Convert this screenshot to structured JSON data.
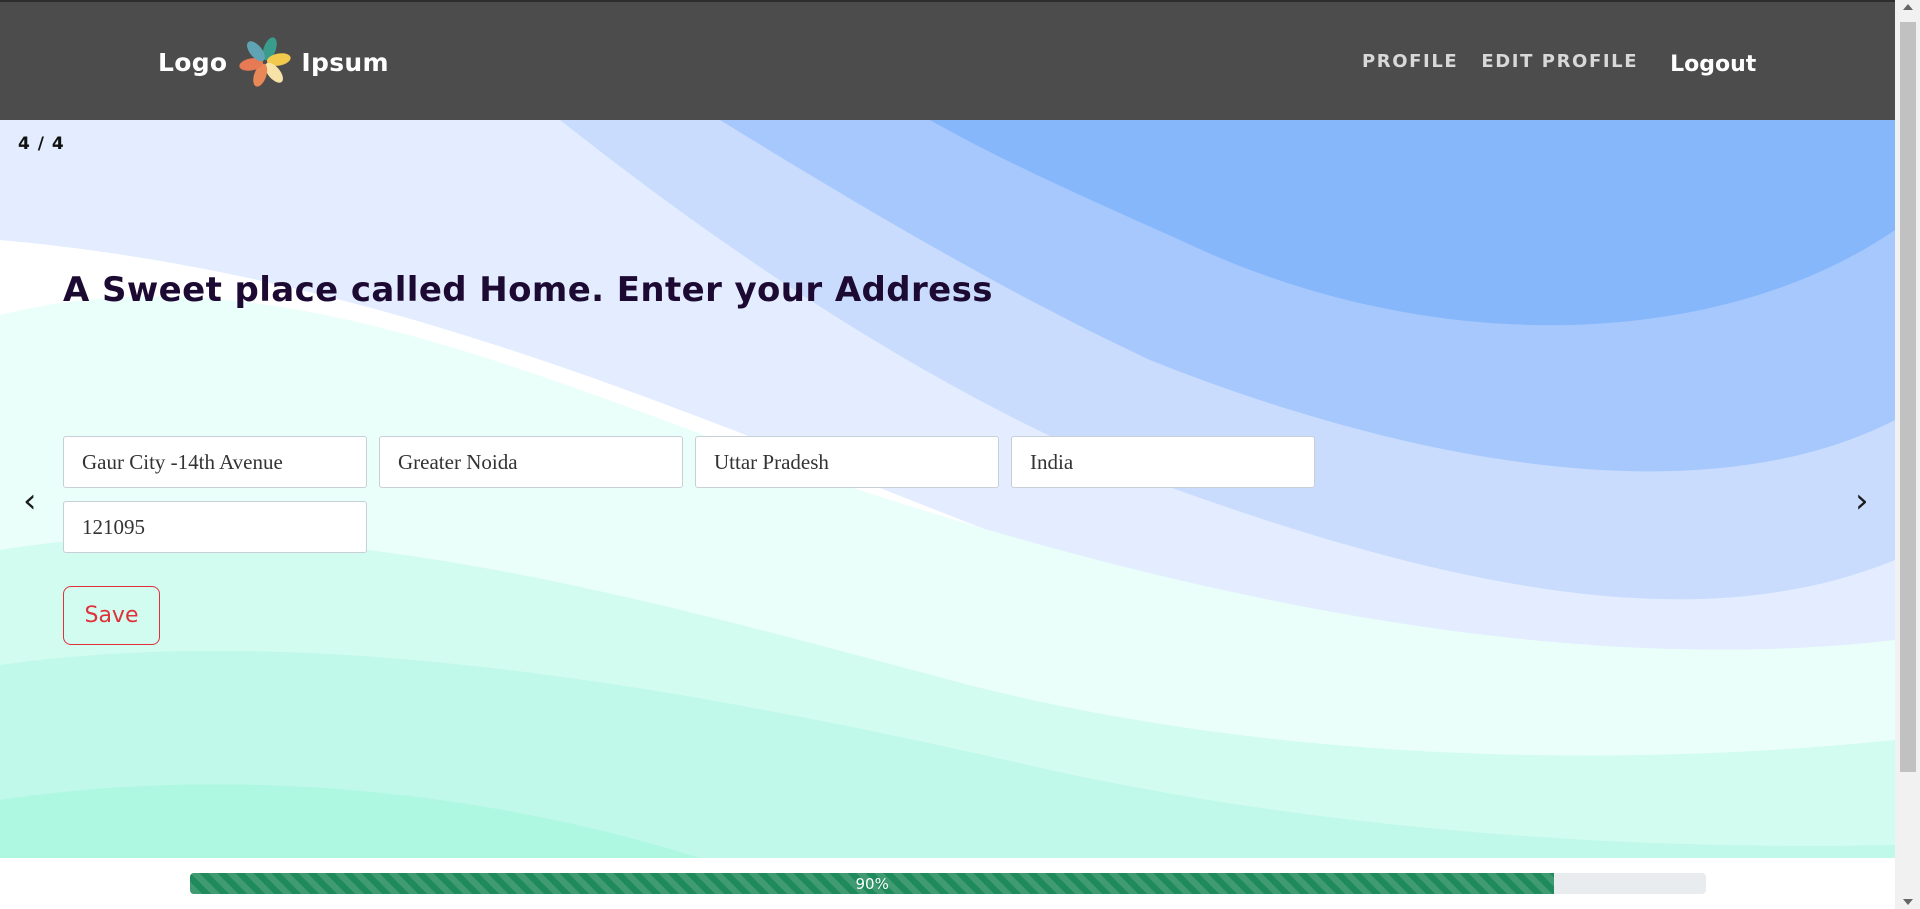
{
  "header": {
    "logo": {
      "left_word": "Logo",
      "right_word": "Ipsum",
      "icon": "pinwheel-logo-icon"
    },
    "nav": [
      {
        "label": "PROFILE"
      },
      {
        "label": "EDIT PROFILE"
      }
    ],
    "logout_label": "Logout",
    "background_color": "#4c4c4c"
  },
  "carousel": {
    "counter": "4 / 4",
    "prev_icon": "chevron-left-icon",
    "next_icon": "chevron-right-icon",
    "prev_glyph": "‹",
    "next_glyph": "›"
  },
  "form": {
    "heading": "A Sweet place called Home. Enter your Address",
    "fields": [
      {
        "value": "Gaur City -14th Avenue"
      },
      {
        "value": "Greater Noida"
      },
      {
        "value": "Uttar Pradesh"
      },
      {
        "value": "India"
      },
      {
        "value": "121095"
      }
    ],
    "save_label": "Save",
    "save_color": "#e0303a"
  },
  "progress": {
    "label": "90%",
    "value_percent": 90,
    "color": "#1f8a5b"
  }
}
